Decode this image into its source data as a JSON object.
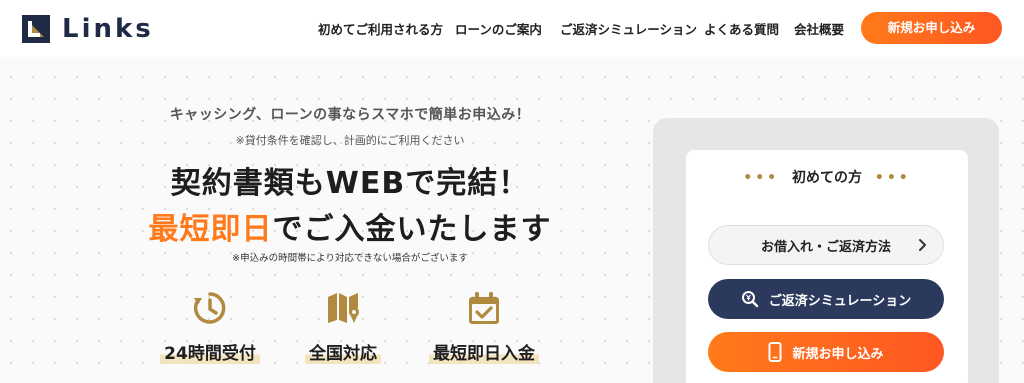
{
  "header": {
    "logo_text": "Links",
    "nav": [
      {
        "label": "初めてご利用される方"
      },
      {
        "label": "ローンのご案内"
      },
      {
        "label": "ご返済シミュレーション"
      },
      {
        "label": "よくある質問"
      },
      {
        "label": "会社概要"
      }
    ],
    "cta_label": "新規お申し込み"
  },
  "hero": {
    "lead": "キャッシング、ローンの事ならスマホで簡単お申込み！",
    "note1": "※貸付条件を確認し、計画的にご利用ください",
    "headline1": "契約書類もWEBで完結！",
    "headline2_accent": "最短即日",
    "headline2_rest": "でご入金いたします",
    "note2": "※申込みの時間帯により対応できない場合がございます",
    "features": [
      {
        "icon": "clock-icon",
        "label": "24時間受付"
      },
      {
        "icon": "map-icon",
        "label": "全国対応"
      },
      {
        "icon": "calendar-check-icon",
        "label": "最短即日入金"
      }
    ]
  },
  "sidebar_card": {
    "title": "初めての方",
    "buttons": [
      {
        "label": "お借入れ・ご返済方法",
        "icon": "chevron-right-icon"
      },
      {
        "label": "ご返済シミュレーション",
        "icon": "search-yen-icon"
      },
      {
        "label": "新規お申し込み",
        "icon": "smartphone-icon"
      }
    ]
  },
  "colors": {
    "accent_orange": "#ff7a1a",
    "navy": "#2b3a5c",
    "gold": "#b08a3e"
  }
}
